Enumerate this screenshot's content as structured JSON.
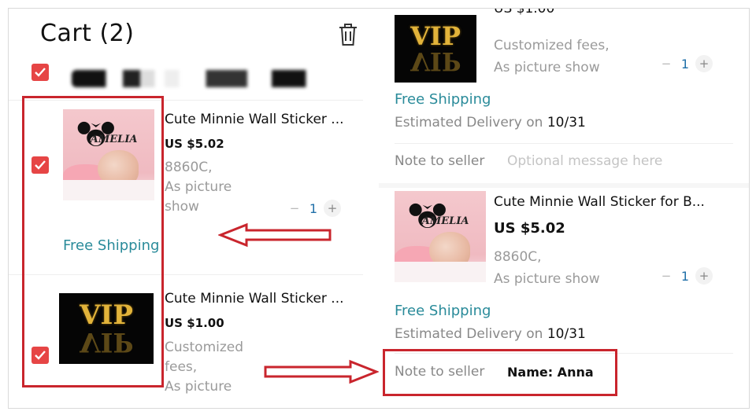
{
  "cart": {
    "title": "Cart (2)",
    "items": [
      {
        "title": "Cute Minnie Wall Sticker ...",
        "price": "US $5.02",
        "variant_line1": "8860C,",
        "variant_line2": "As picture",
        "variant_line3": "show",
        "qty": "1",
        "shipping": "Free Shipping",
        "image_text": "AMELIA"
      },
      {
        "title": "Cute Minnie Wall Sticker ...",
        "price": "US $1.00",
        "variant_line1": "Customized",
        "variant_line2": "fees,",
        "variant_line3": "As picture",
        "image_text": "VIP"
      }
    ]
  },
  "checkout": {
    "top_item": {
      "price_partial": "US $1.00",
      "variant_line1": "Customized fees,",
      "variant_line2": "As picture show",
      "qty": "1",
      "image_text": "VIP"
    },
    "shipping_1": "Free Shipping",
    "delivery_1_label": "Estimated Delivery on ",
    "delivery_1_date": "10/31",
    "note_1_label": "Note to seller",
    "note_1_placeholder": "Optional message here",
    "item_2": {
      "title": "Cute Minnie Wall Sticker for B...",
      "price": "US $5.02",
      "variant_line1": "8860C,",
      "variant_line2": "As picture show",
      "qty": "1",
      "image_text": "AMELIA"
    },
    "shipping_2": "Free Shipping",
    "delivery_2_label": "Estimated Delivery on ",
    "delivery_2_date": "10/31",
    "note_2_label": "Note to seller",
    "note_2_value": "Name: Anna"
  },
  "icons": {
    "stepper_minus": "−",
    "stepper_plus": "+"
  },
  "colors": {
    "accent_red": "#e64545",
    "annotation_red": "#c9252d",
    "shipping_teal": "#2a8b9a",
    "qty_blue": "#1f6fa8"
  }
}
